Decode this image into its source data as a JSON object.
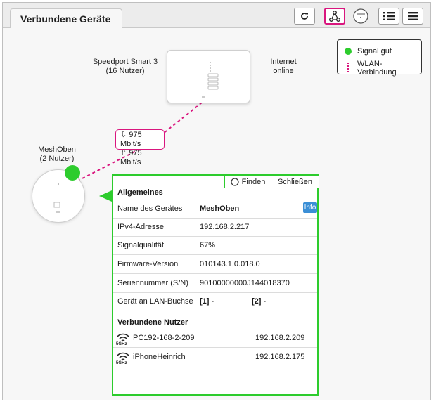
{
  "header": {
    "title": "Verbundene Geräte"
  },
  "toolbar": {
    "buttons": [
      "refresh",
      "mesh-view",
      "device-view",
      "list-view",
      "menu"
    ]
  },
  "legend": {
    "signal_good": "Signal gut",
    "wlan_connection": "WLAN-Verbindung"
  },
  "router": {
    "name": "Speedport Smart 3",
    "users": "(16 Nutzer)",
    "internet_label": "Internet",
    "internet_status": "online"
  },
  "mesh": {
    "name": "MeshOben",
    "users": "(2 Nutzer)"
  },
  "link": {
    "speed_1": "975 Mbit/s",
    "speed_2": "975 Mbit/s"
  },
  "panel": {
    "find_label": "Finden",
    "close_label": "Schließen",
    "general_title": "Allgemeines",
    "info_label": "Info",
    "rows": [
      {
        "key": "Name des Gerätes",
        "value": "MeshOben"
      },
      {
        "key": "IPv4-Adresse",
        "value": "192.168.2.217"
      },
      {
        "key": "Signalqualität",
        "value": "67%"
      },
      {
        "key": "Firmware-Version",
        "value": "010143.1.0.018.0"
      },
      {
        "key": "Seriennummer (S/N)",
        "value": "90100000000J144018370"
      }
    ],
    "lan": {
      "key": "Gerät an LAN-Buchse",
      "port1": "[1]",
      "port1_val": "-",
      "port2": "[2]",
      "port2_val": "-"
    },
    "users_title": "Verbundene Nutzer",
    "users": [
      {
        "band": "5GHz",
        "name": "PC192-168-2-209",
        "ip": "192.168.2.209"
      },
      {
        "band": "5GHz",
        "name": "iPhoneHeinrich",
        "ip": "192.168.2.175"
      }
    ]
  },
  "colors": {
    "accent": "#d9167e",
    "signal": "#2dcc2d",
    "info": "#3b8fd6"
  }
}
